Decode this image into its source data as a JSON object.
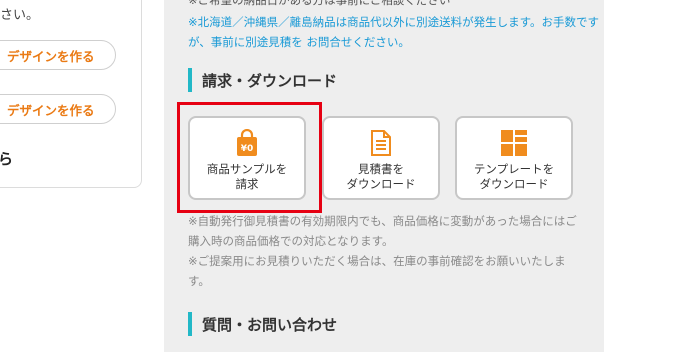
{
  "left": {
    "top_text": "さい。",
    "buttons": [
      "デザインを作る",
      "デザインを作る"
    ],
    "heading_fragment": "ら"
  },
  "panel": {
    "cut_line": "※ご希望の納品日がある方は事前にご相談ください",
    "shipping_notice": "※北海道／沖縄県／離島納品は商品代以外に別途送料が発生します。お手数ですが、事前に別途見積を お問合せください。",
    "section_billing": "請求・ダウンロード",
    "tiles": [
      {
        "label": "商品サンプルを\n請求",
        "icon": "shopping-bag-icon"
      },
      {
        "label": "見積書を\nダウンロード",
        "icon": "document-icon"
      },
      {
        "label": "テンプレートを\nダウンロード",
        "icon": "template-icon"
      }
    ],
    "note1": "※自動発行御見積書の有効期限内でも、商品価格に変動があった場合にはご購入時の商品価格での対応となります。",
    "note2": "※ご提案用にお見積りいただく場合は、在庫の事前確認をお願いいたします。",
    "section_faq": "質問・お問い合わせ",
    "bag_badge": "¥0"
  },
  "colors": {
    "accent_orange": "#f08c1e",
    "button_text": "#ea7a14",
    "notice_blue": "#1a9ad6",
    "heading_bar": "#22b8c7",
    "highlight_red": "#e60012"
  }
}
